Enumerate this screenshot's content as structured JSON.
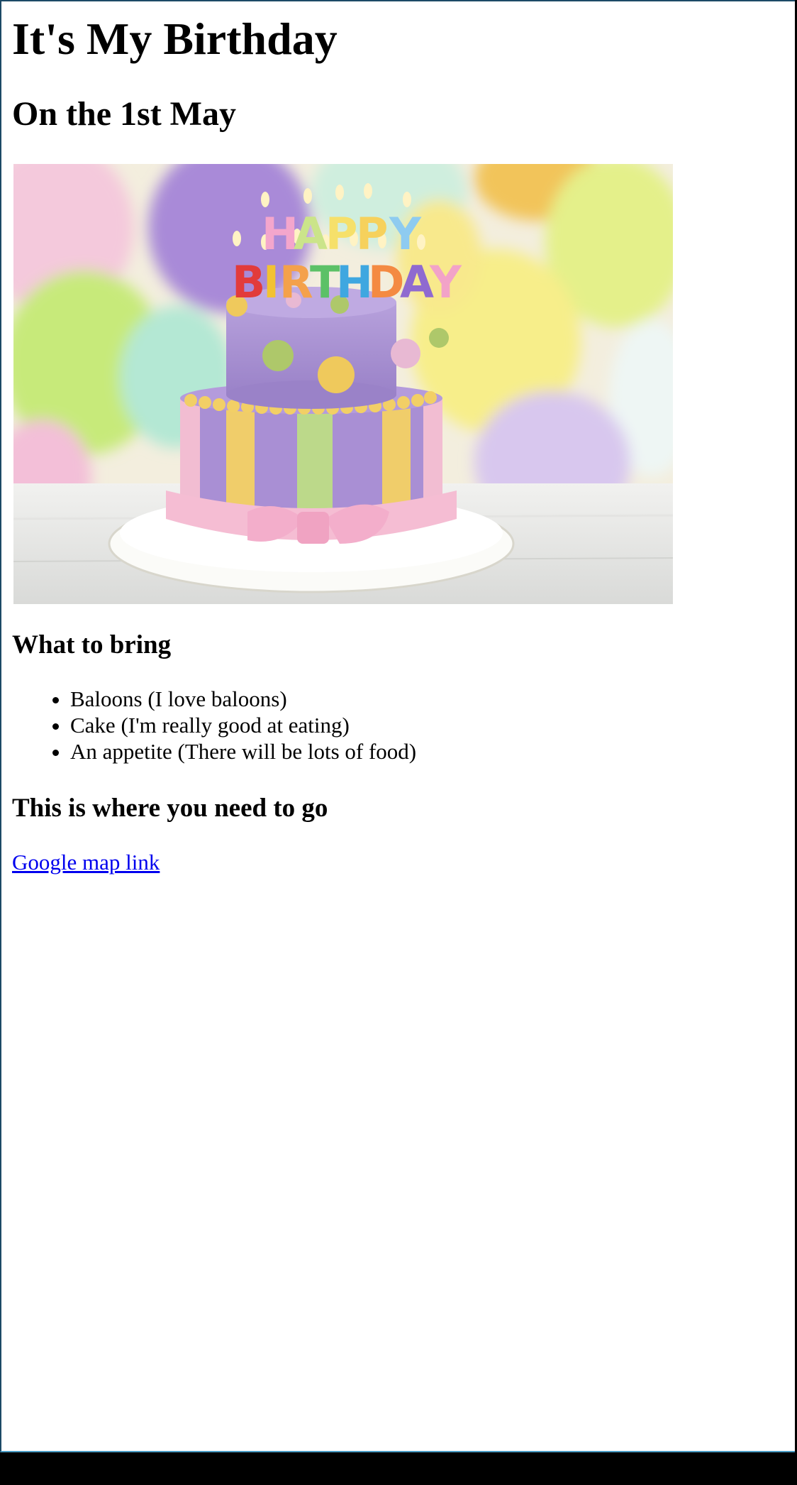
{
  "header": {
    "title": "It's My Birthday",
    "subtitle": "On the 1st May"
  },
  "photo": {
    "subject": "birthday-cake",
    "cake_letters_top": "HAPPY",
    "cake_letters_bottom": "BIRTHDAY"
  },
  "bring": {
    "heading": "What to bring",
    "items": [
      "Baloons (I love baloons)",
      "Cake (I'm really good at eating)",
      "An appetite (There will be lots of food)"
    ]
  },
  "directions": {
    "heading": "This is where you need to go",
    "link_label": "Google map link"
  },
  "colors": {
    "link": "#0000ee",
    "frame": "#1c4a66",
    "text": "#000000"
  }
}
